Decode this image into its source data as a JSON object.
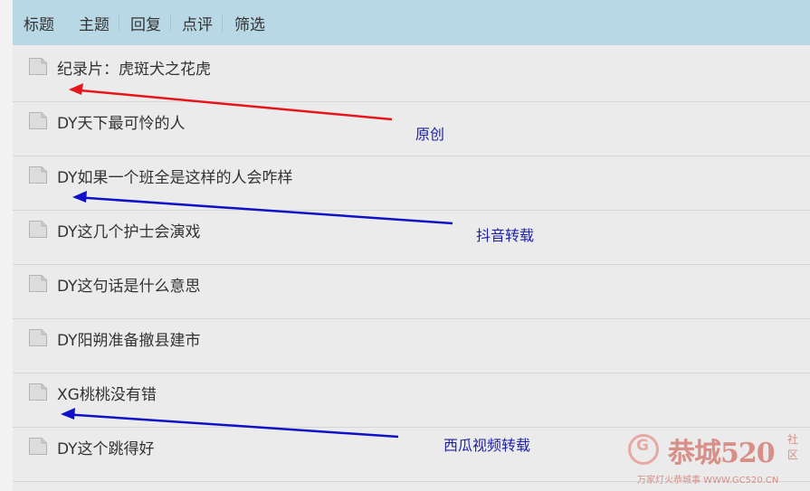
{
  "header": {
    "title": "标题",
    "filters": [
      "主题",
      "回复",
      "点评",
      "筛选"
    ]
  },
  "threads": [
    {
      "title": "纪录片：虎斑犬之花虎"
    },
    {
      "title": "DY天下最可怜的人"
    },
    {
      "title": "DY如果一个班全是这样的人会咋样"
    },
    {
      "title": "DY这几个护士会演戏"
    },
    {
      "title": "DY这句话是什么意思"
    },
    {
      "title": "DY阳朔准备撤县建市"
    },
    {
      "title": "XG桃桃没有错"
    },
    {
      "title": "DY这个跳得好"
    }
  ],
  "annotations": {
    "original": "原创",
    "douyin": "抖音转载",
    "xigua": "西瓜视频转载",
    "colors": {
      "red_arrow": "#e8141c",
      "blue_arrow": "#1010c8",
      "text": "#1f1fa8"
    }
  },
  "watermark": {
    "logo_glyph": "G",
    "main": "恭城520",
    "side": "社区",
    "sub": "万家灯火恭城事 WWW.GC520.CN"
  },
  "icons": {
    "thread": "document-icon"
  }
}
